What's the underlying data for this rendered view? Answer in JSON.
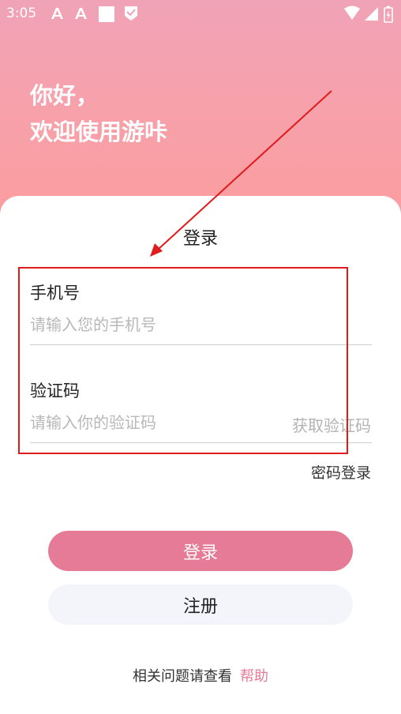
{
  "status_bar": {
    "time": "3:05"
  },
  "greeting": {
    "line1": "你好，",
    "line2": "欢迎使用游咔"
  },
  "form": {
    "title": "登录",
    "phone": {
      "label": "手机号",
      "placeholder": "请输入您的手机号"
    },
    "code": {
      "label": "验证码",
      "placeholder": "请输入你的验证码",
      "get_code": "获取验证码"
    },
    "password_login": "密码登录"
  },
  "buttons": {
    "login": "登录",
    "register": "注册"
  },
  "footer": {
    "text": "相关问题请查看",
    "help": "帮助"
  },
  "colors": {
    "accent": "#e57b96",
    "annotation": "#e01b1b"
  }
}
